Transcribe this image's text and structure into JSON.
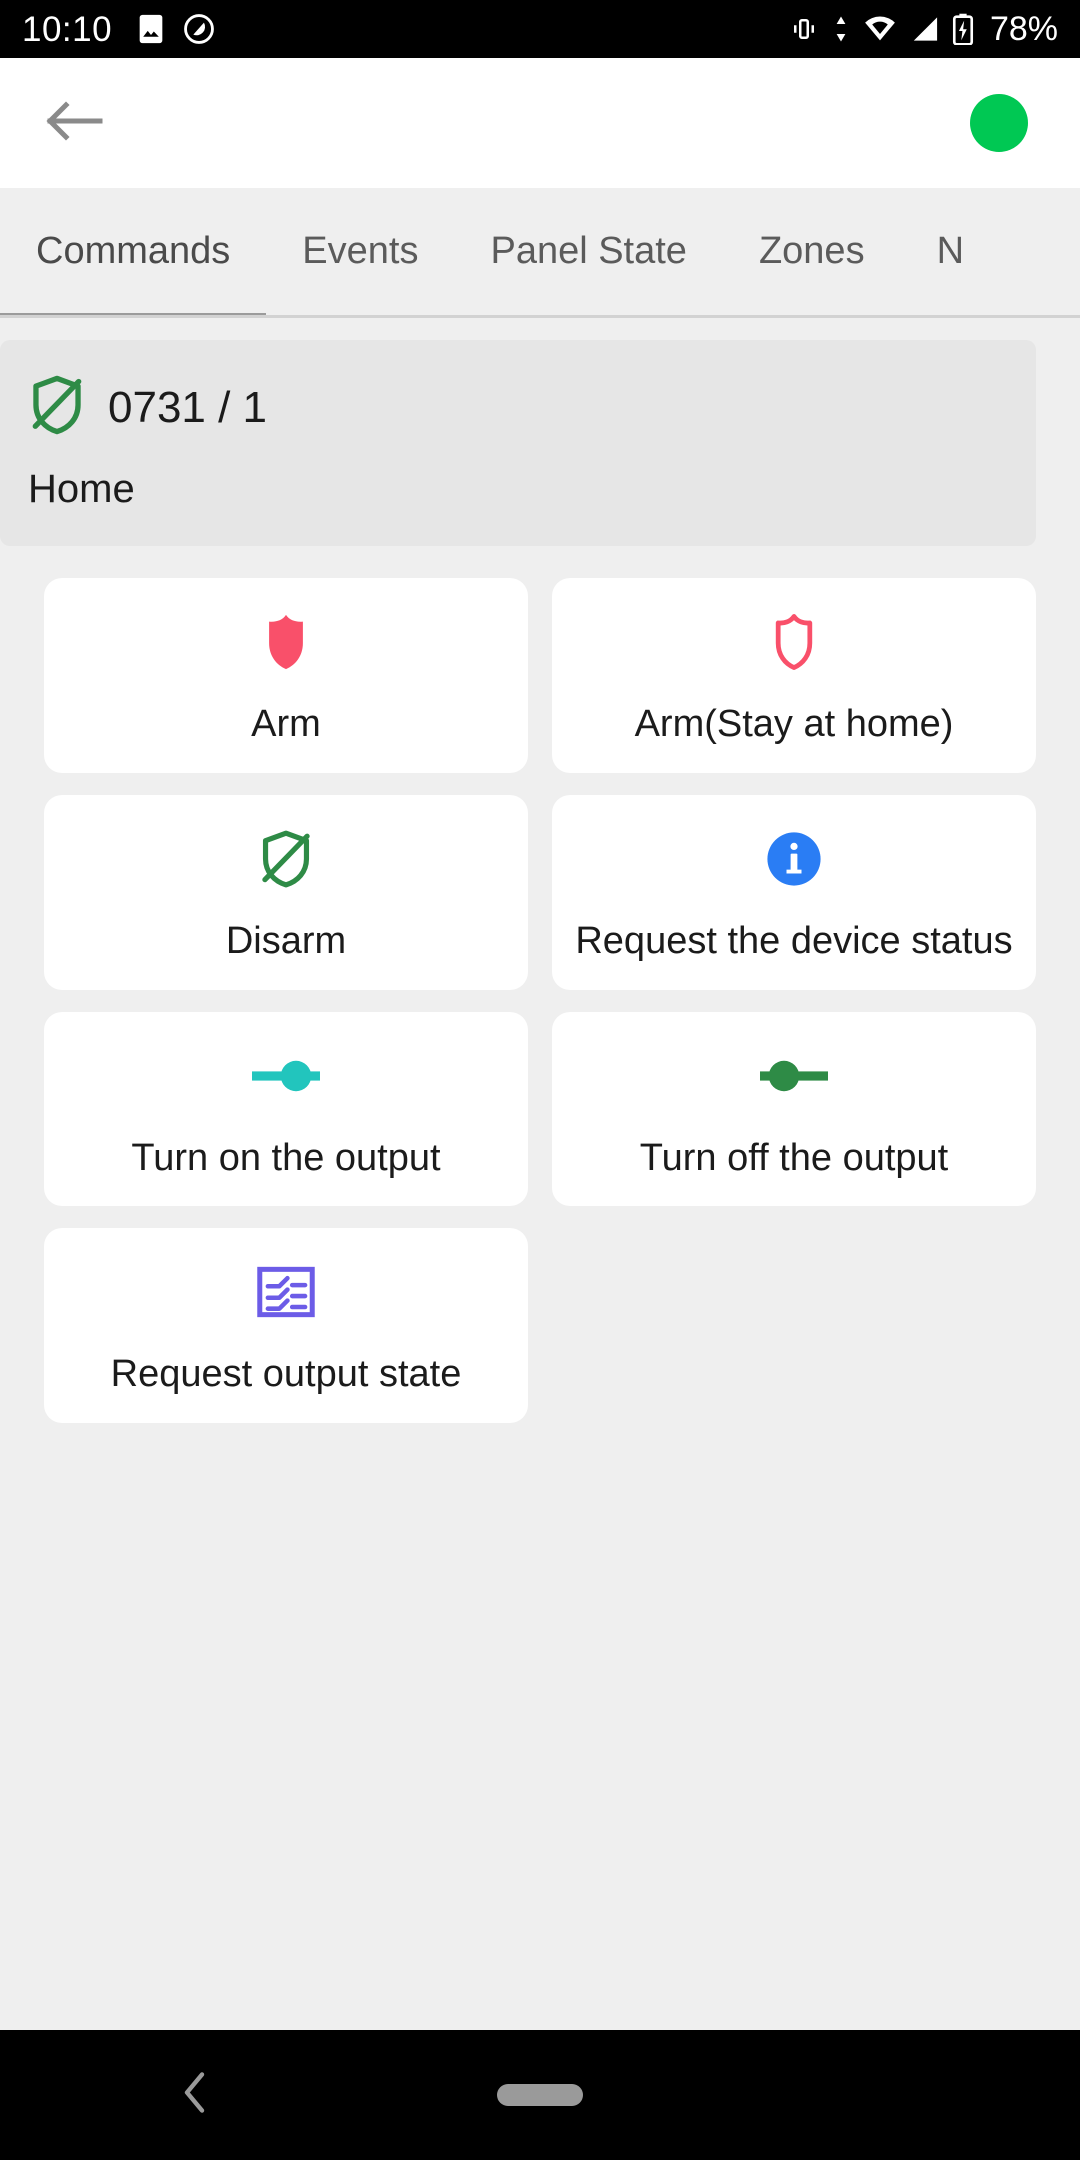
{
  "status_bar": {
    "time": "10:10",
    "battery_percent": "78%",
    "left_icons": [
      "image-icon",
      "no-entry-icon"
    ],
    "right_icons": [
      "vibrate-icon",
      "data-transfer-icon",
      "wifi-icon",
      "cellular-signal-icon",
      "battery-charging-icon"
    ]
  },
  "app_bar": {
    "back_icon": "back-arrow-icon",
    "connection_status_color": "#00c853"
  },
  "tabs": [
    {
      "label": "Commands",
      "active": true
    },
    {
      "label": "Events",
      "active": false
    },
    {
      "label": "Panel State",
      "active": false
    },
    {
      "label": "Zones",
      "active": false
    },
    {
      "label": "N",
      "active": false
    }
  ],
  "panel": {
    "icon": "shield-off-icon",
    "icon_color": "#2e8b46",
    "title": "0731 / 1",
    "subtitle": "Home"
  },
  "commands": [
    {
      "label": "Arm",
      "icon": "shield-filled-icon",
      "color": "#f9506a"
    },
    {
      "label": "Arm(Stay at home)",
      "icon": "shield-outline-icon",
      "color": "#f9506a"
    },
    {
      "label": "Disarm",
      "icon": "shield-off-icon",
      "color": "#2e8b46"
    },
    {
      "label": "Request the device status",
      "icon": "info-circle-icon",
      "color": "#2a7df4"
    },
    {
      "label": "Turn on the output",
      "icon": "toggle-on-icon",
      "color": "#22c5bd"
    },
    {
      "label": "Turn off the output",
      "icon": "toggle-off-icon",
      "color": "#2e8b46"
    },
    {
      "label": "Request output state",
      "icon": "list-state-icon",
      "color": "#6c5ce7"
    }
  ],
  "nav_bar": {
    "back_icon": "nav-back-icon",
    "home_pill": "nav-home-pill"
  }
}
